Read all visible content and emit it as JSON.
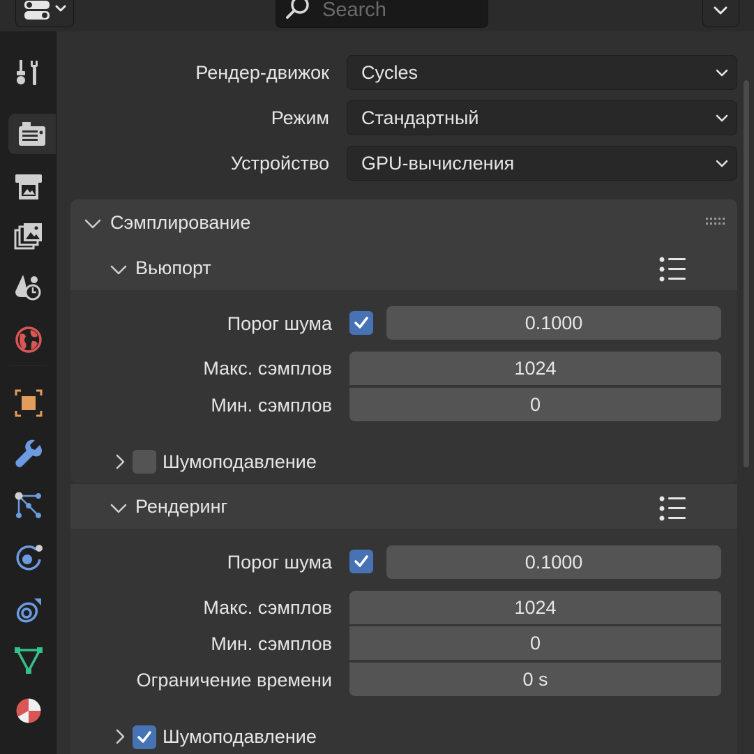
{
  "header": {
    "search_placeholder": "Search"
  },
  "tabs": [
    {
      "name": "tool-tab",
      "icon": "tool-icon",
      "active": false
    },
    {
      "name": "render-tab",
      "icon": "render-icon",
      "active": true
    },
    {
      "name": "output-tab",
      "icon": "output-icon",
      "active": false
    },
    {
      "name": "view-layer-tab",
      "icon": "view-layer-icon",
      "active": false
    },
    {
      "name": "scene-tab",
      "icon": "scene-icon",
      "active": false
    },
    {
      "name": "world-tab",
      "icon": "world-icon",
      "active": false
    },
    {
      "name": "object-tab",
      "icon": "object-icon",
      "active": false
    },
    {
      "name": "modifier-tab",
      "icon": "wrench-icon",
      "active": false
    },
    {
      "name": "particles-tab",
      "icon": "particles-icon",
      "active": false
    },
    {
      "name": "physics-tab",
      "icon": "physics-icon",
      "active": false
    },
    {
      "name": "constraints-tab",
      "icon": "constraint-icon",
      "active": false
    },
    {
      "name": "data-tab",
      "icon": "mesh-data-icon",
      "active": false
    },
    {
      "name": "material-tab",
      "icon": "material-icon",
      "active": false
    }
  ],
  "render": {
    "engine_label": "Рендер-движок",
    "engine_value": "Cycles",
    "mode_label": "Режим",
    "mode_value": "Стандартный",
    "device_label": "Устройство",
    "device_value": "GPU-вычисления"
  },
  "sampling": {
    "title": "Сэмплирование",
    "viewport": {
      "title": "Вьюпорт",
      "noise_threshold_label": "Порог шума",
      "noise_threshold_enabled": true,
      "noise_threshold_value": "0.1000",
      "max_samples_label": "Макс. сэмплов",
      "max_samples_value": "1024",
      "min_samples_label": "Мин. сэмплов",
      "min_samples_value": "0",
      "denoise_label": "Шумоподавление",
      "denoise_enabled": false
    },
    "render": {
      "title": "Рендеринг",
      "noise_threshold_label": "Порог шума",
      "noise_threshold_enabled": true,
      "noise_threshold_value": "0.1000",
      "max_samples_label": "Макс. сэмплов",
      "max_samples_value": "1024",
      "min_samples_label": "Мин. сэмплов",
      "min_samples_value": "0",
      "time_limit_label": "Ограничение времени",
      "time_limit_value": "0 s",
      "denoise_label": "Шумоподавление",
      "denoise_enabled": true
    }
  },
  "colors": {
    "accent": "#4772b3",
    "object_orange": "#e09d5b",
    "modifier_blue": "#6b9be0",
    "mesh_green": "#35c08a",
    "world_red": "#d95656"
  }
}
